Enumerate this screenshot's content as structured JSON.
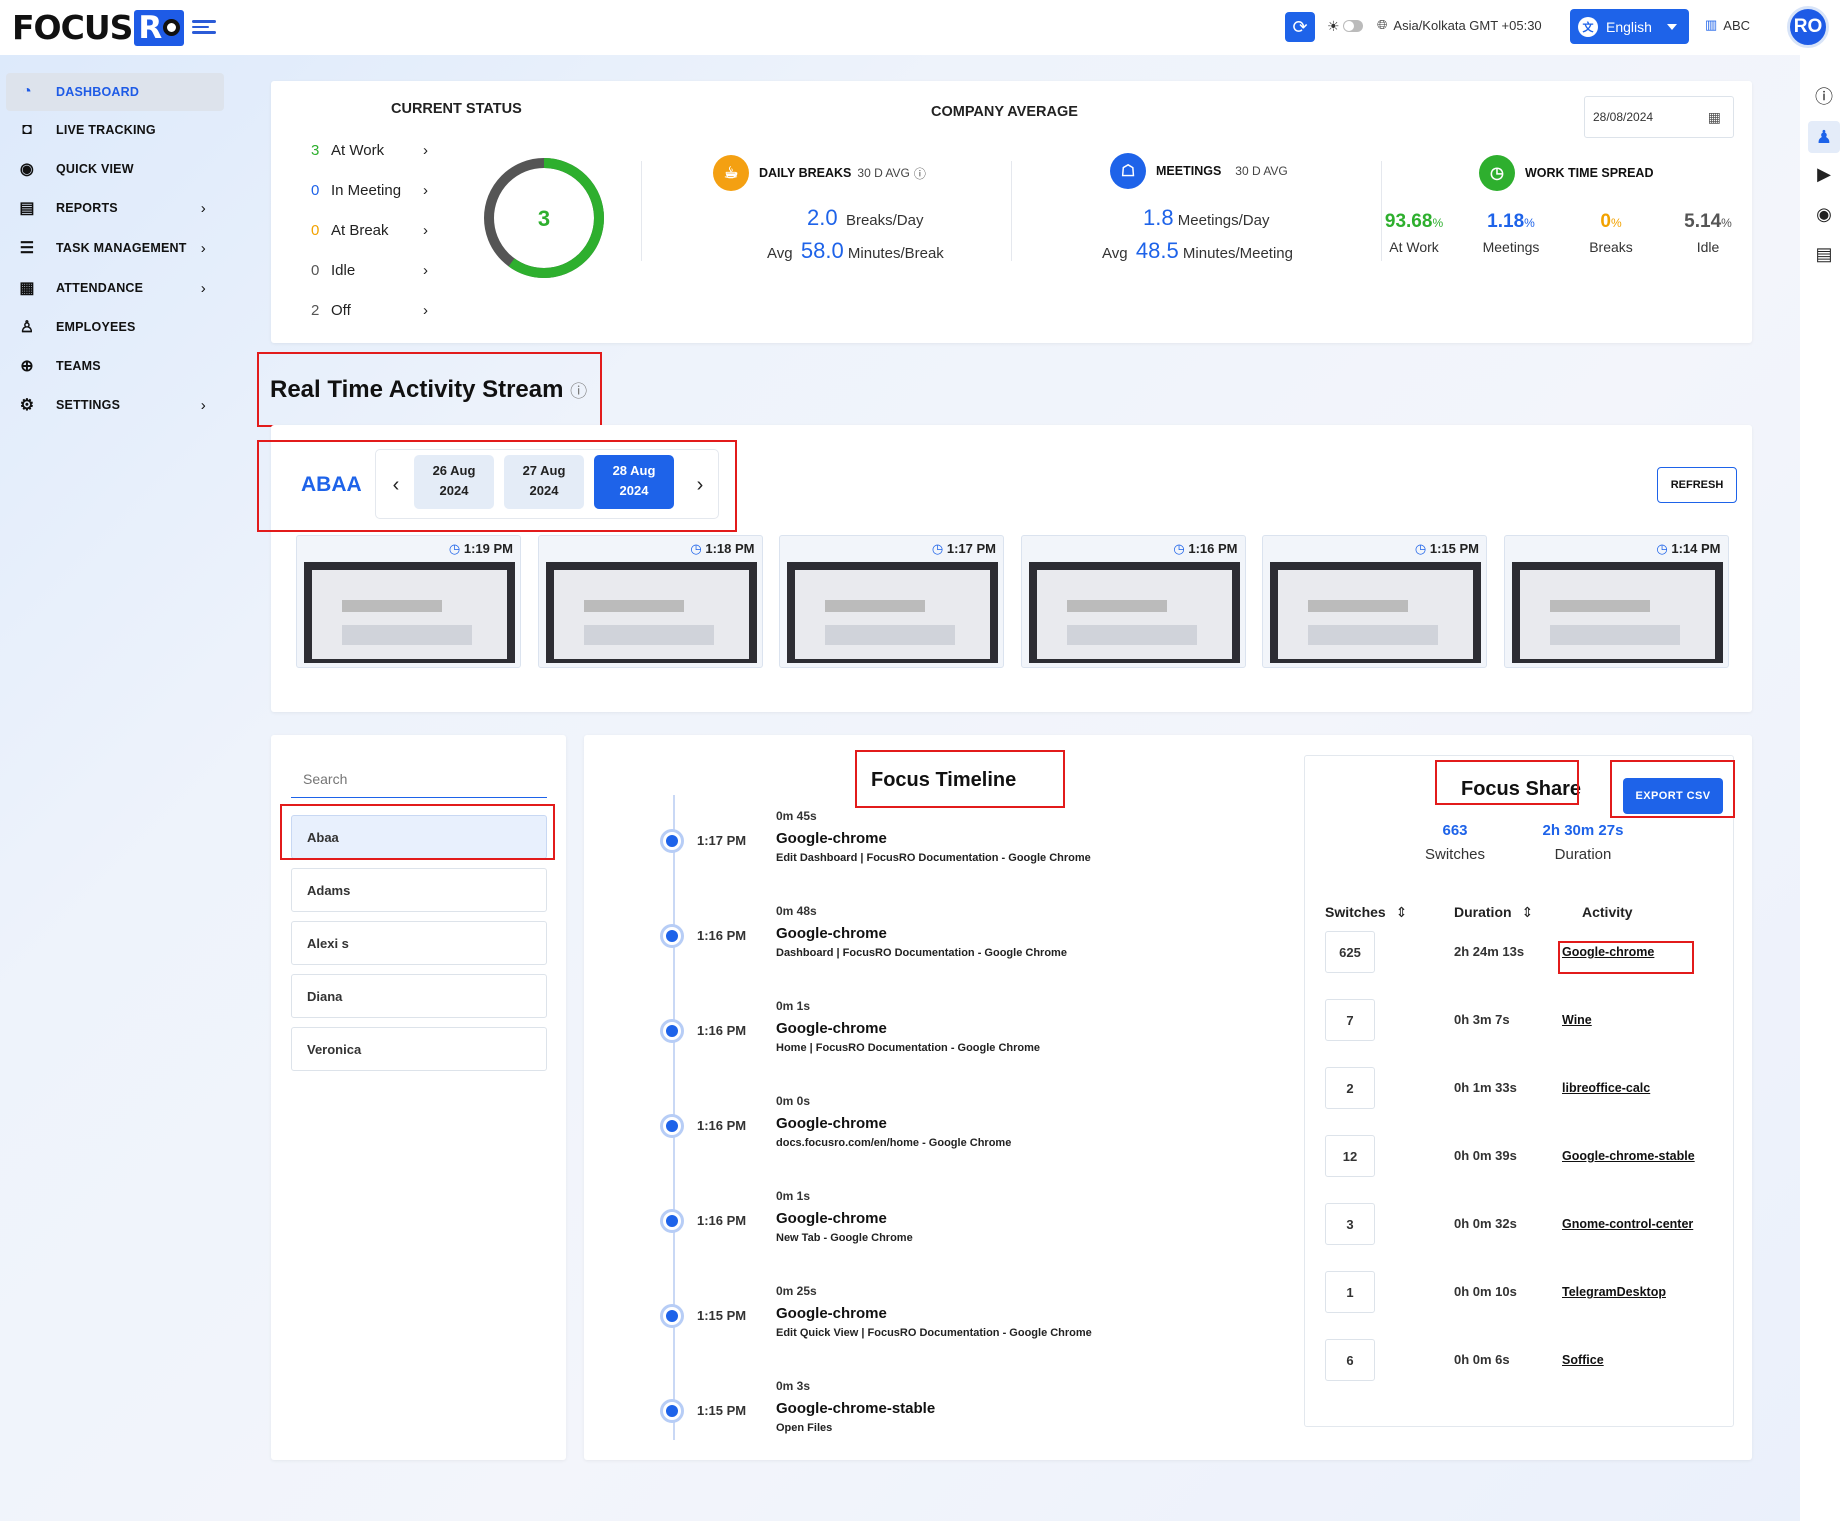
{
  "app": {
    "logo_text": "FOCUS",
    "logo_badge": "R"
  },
  "topbar": {
    "timezone": "Asia/Kolkata GMT +05:30",
    "language": "English",
    "language_icon": "translate-icon",
    "org": "ABC",
    "avatar": "RO"
  },
  "sidebar": {
    "items": [
      {
        "label": "DASHBOARD",
        "icon": "◔",
        "active": true,
        "chevron": false
      },
      {
        "label": "LIVE TRACKING",
        "icon": "◘",
        "chevron": false
      },
      {
        "label": "QUICK VIEW",
        "icon": "◉",
        "chevron": false
      },
      {
        "label": "REPORTS",
        "icon": "▤",
        "chevron": true
      },
      {
        "label": "TASK MANAGEMENT",
        "icon": "☰",
        "chevron": true
      },
      {
        "label": "ATTENDANCE",
        "icon": "▦",
        "chevron": true
      },
      {
        "label": "EMPLOYEES",
        "icon": "♙",
        "chevron": false
      },
      {
        "label": "TEAMS",
        "icon": "⊕",
        "chevron": false
      },
      {
        "label": "SETTINGS",
        "icon": "⚙",
        "chevron": true
      }
    ]
  },
  "current_status": {
    "title": "CURRENT STATUS",
    "donut_value": "3",
    "donut_fraction": 0.6,
    "rows": [
      {
        "count": "3",
        "label": "At Work",
        "color": "#2eaf2e"
      },
      {
        "count": "0",
        "label": "In Meeting",
        "color": "#1e63e9"
      },
      {
        "count": "0",
        "label": "At Break",
        "color": "#f2a200"
      },
      {
        "count": "0",
        "label": "Idle",
        "color": "#555555"
      },
      {
        "count": "2",
        "label": "Off",
        "color": "#555555"
      }
    ]
  },
  "company_average": {
    "title": "COMPANY AVERAGE",
    "date": "28/08/2024",
    "breaks": {
      "label": "DAILY BREAKS",
      "sub": "30 D AVG",
      "value": "2.0",
      "unit": "Breaks/Day",
      "avg_prefix": "Avg",
      "avg": "58.0",
      "avg_unit": "Minutes/Break"
    },
    "meetings": {
      "label": "MEETINGS",
      "sub": "30 D AVG",
      "value": "1.8",
      "unit": "Meetings/Day",
      "avg_prefix": "Avg",
      "avg": "48.5",
      "avg_unit": "Minutes/Meeting"
    },
    "spread": {
      "label": "WORK TIME SPREAD",
      "items": [
        {
          "value": "93.68",
          "pct": "%",
          "label": "At Work",
          "color": "#2eaf2e"
        },
        {
          "value": "1.18",
          "pct": "%",
          "label": "Meetings",
          "color": "#1e63e9"
        },
        {
          "value": "0",
          "pct": "%",
          "label": "Breaks",
          "color": "#f2a200"
        },
        {
          "value": "5.14",
          "pct": "%",
          "label": "Idle",
          "color": "#555555"
        }
      ]
    }
  },
  "stream": {
    "title": "Real Time Activity Stream",
    "user": "ABAA",
    "refresh": "REFRESH",
    "dates": [
      {
        "day": "26 Aug",
        "year": "2024"
      },
      {
        "day": "27 Aug",
        "year": "2024"
      },
      {
        "day": "28 Aug",
        "year": "2024"
      }
    ],
    "shots": [
      "1:19 PM",
      "1:18 PM",
      "1:17 PM",
      "1:16 PM",
      "1:15 PM",
      "1:14 PM"
    ]
  },
  "employees": {
    "search_placeholder": "Search",
    "items": [
      "Abaa",
      "Adams",
      "Alexi s",
      "Diana",
      "Veronica"
    ]
  },
  "timeline": {
    "title": "Focus Timeline",
    "items": [
      {
        "time": "1:17 PM",
        "dur": "0m 45s",
        "app": "Google-chrome",
        "title": "Edit Dashboard | FocusRO Documentation - Google Chrome"
      },
      {
        "time": "1:16 PM",
        "dur": "0m 48s",
        "app": "Google-chrome",
        "title": "Dashboard | FocusRO Documentation - Google Chrome"
      },
      {
        "time": "1:16 PM",
        "dur": "0m 1s",
        "app": "Google-chrome",
        "title": "Home | FocusRO Documentation - Google Chrome"
      },
      {
        "time": "1:16 PM",
        "dur": "0m 0s",
        "app": "Google-chrome",
        "title": "docs.focusro.com/en/home - Google Chrome"
      },
      {
        "time": "1:16 PM",
        "dur": "0m 1s",
        "app": "Google-chrome",
        "title": "New Tab - Google Chrome"
      },
      {
        "time": "1:15 PM",
        "dur": "0m 25s",
        "app": "Google-chrome",
        "title": "Edit Quick View | FocusRO Documentation - Google Chrome"
      },
      {
        "time": "1:15 PM",
        "dur": "0m 3s",
        "app": "Google-chrome-stable",
        "title": "Open Files"
      }
    ]
  },
  "focus_share": {
    "title": "Focus Share",
    "export": "EXPORT CSV",
    "switches": "663",
    "switches_label": "Switches",
    "duration": "2h 30m 27s",
    "duration_label": "Duration",
    "cols": [
      "Switches",
      "Duration",
      "Activity"
    ],
    "rows": [
      {
        "sw": "625",
        "du": "2h 24m 13s",
        "ac": "Google-chrome"
      },
      {
        "sw": "7",
        "du": "0h 3m 7s",
        "ac": "Wine"
      },
      {
        "sw": "2",
        "du": "0h 1m 33s",
        "ac": "libreoffice-calc"
      },
      {
        "sw": "12",
        "du": "0h 0m 39s",
        "ac": "Google-chrome-stable"
      },
      {
        "sw": "3",
        "du": "0h 0m 32s",
        "ac": "Gnome-control-center"
      },
      {
        "sw": "1",
        "du": "0h 0m 10s",
        "ac": "TelegramDesktop"
      },
      {
        "sw": "6",
        "du": "0h 0m 6s",
        "ac": "Soffice"
      }
    ]
  }
}
